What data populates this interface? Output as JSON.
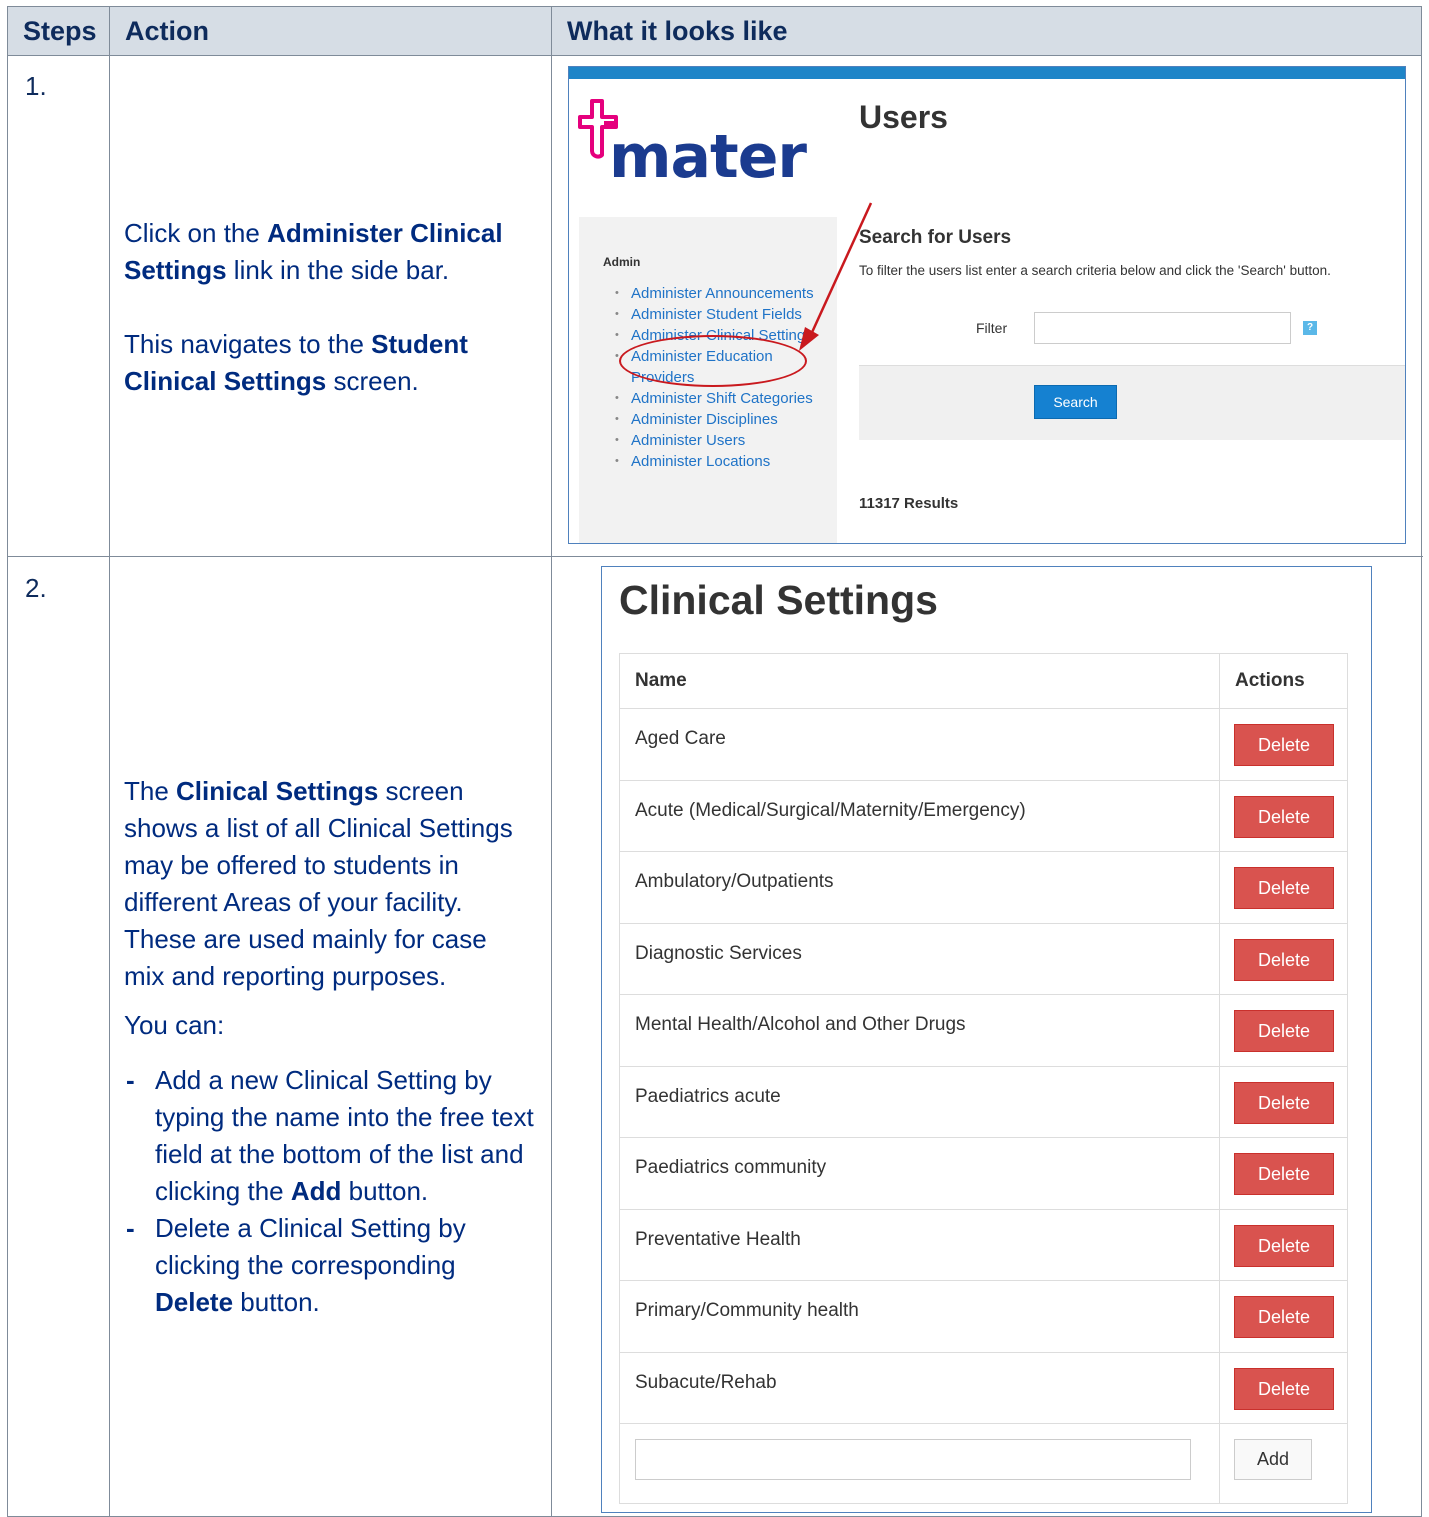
{
  "header": {
    "steps": "Steps",
    "action": "Action",
    "what": "What it looks like"
  },
  "step1": {
    "number": "1.",
    "text1_pre": "Click on the ",
    "text1_bold": "Administer Clinical Settings",
    "text1_post": " link in the side bar.",
    "text2_pre": "This navigates to the ",
    "text2_bold": "Student Clinical Settings",
    "text2_post": " screen."
  },
  "step2": {
    "number": "2.",
    "p1_pre": "The ",
    "p1_bold": "Clinical Settings",
    "p1_post": " screen shows a list of all Clinical Settings may be offered to students in different Areas of your facility. These are used mainly for case mix and reporting purposes.",
    "p2": "You can:",
    "b1_pre": "Add a new Clinical Setting by typing the name into the free text field at the bottom of the list and clicking the ",
    "b1_bold": "Add",
    "b1_post": " button.",
    "b2_pre": "Delete a Clinical Setting by clicking the corresponding ",
    "b2_bold": "Delete",
    "b2_post": " button."
  },
  "screen1": {
    "logo": "mater",
    "title": "Users",
    "sidebar_heading": "Admin",
    "sidebar_items": [
      "Administer Announcements",
      "Administer Student Fields",
      "Administer Clinical Settings",
      "Administer Education Providers",
      "Administer Shift Categories",
      "Administer Disciplines",
      "Administer Users",
      "Administer Locations"
    ],
    "search_heading": "Search for Users",
    "search_desc": "To filter the users list enter a search criteria below and click the 'Search' button.",
    "filter_label": "Filter",
    "help_icon": "?",
    "search_button": "Search",
    "results": "11317 Results"
  },
  "screen2": {
    "title": "Clinical Settings",
    "col_name": "Name",
    "col_actions": "Actions",
    "rows": [
      "Aged Care",
      "Acute (Medical/Surgical/Maternity/Emergency)",
      "Ambulatory/Outpatients",
      "Diagnostic Services",
      "Mental Health/Alcohol and Other Drugs",
      "Paediatrics acute",
      "Paediatrics community",
      "Preventative Health",
      "Primary/Community health",
      "Subacute/Rehab"
    ],
    "delete_label": "Delete",
    "add_label": "Add"
  },
  "colors": {
    "brand_blue": "#1e85c8",
    "delete_red": "#d9534f",
    "highlight_red": "#c9191e",
    "text_navy": "#002b7f"
  }
}
